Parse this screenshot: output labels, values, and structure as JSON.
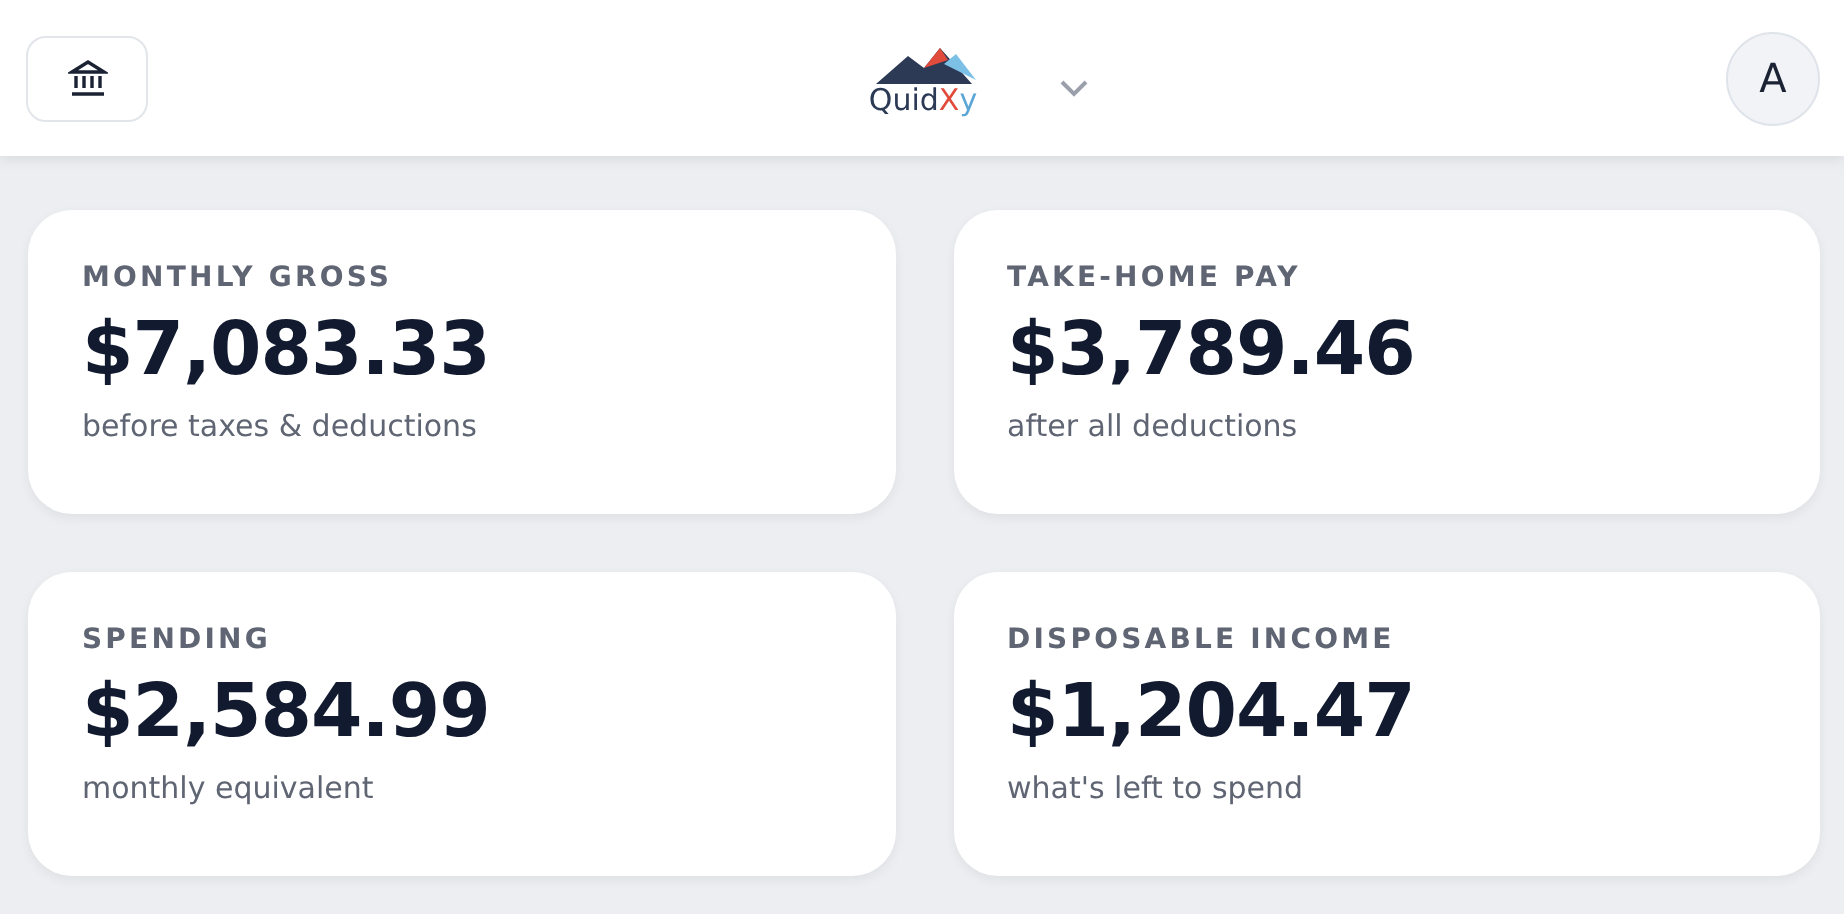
{
  "header": {
    "logo": {
      "parts": [
        "Quid",
        "Xy"
      ]
    },
    "avatar": "A"
  },
  "cards": [
    {
      "label": "MONTHLY GROSS",
      "amount": "$7,083.33",
      "note": "before taxes & deductions"
    },
    {
      "label": "TAKE-HOME PAY",
      "amount": "$3,789.46",
      "note": "after all deductions"
    },
    {
      "label": "SPENDING",
      "amount": "$2,584.99",
      "note": "monthly equivalent"
    },
    {
      "label": "DISPOSABLE INCOME",
      "amount": "$1,204.47",
      "note": "what's left to spend"
    }
  ]
}
